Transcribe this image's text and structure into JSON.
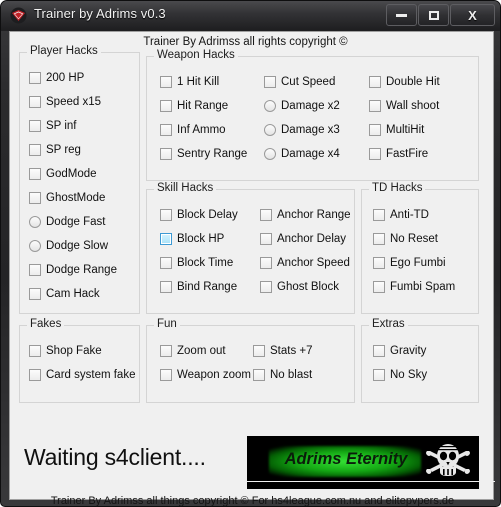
{
  "window": {
    "title": "Trainer by Adrims v0.3",
    "icon": "app-logo-icon",
    "buttons": {
      "minimize": "minimize-icon",
      "maximize": "maximize-icon",
      "close": "X"
    }
  },
  "header": {
    "copyright": "Trainer By Adrimss all rights copyright ©"
  },
  "groups": {
    "player_hacks": {
      "label": "Player Hacks",
      "items": [
        {
          "label": "200 HP",
          "type": "checkbox",
          "checked": false
        },
        {
          "label": "Speed x15",
          "type": "checkbox",
          "checked": false
        },
        {
          "label": "SP inf",
          "type": "checkbox",
          "checked": false
        },
        {
          "label": "SP reg",
          "type": "checkbox",
          "checked": false
        },
        {
          "label": "GodMode",
          "type": "checkbox",
          "checked": false
        },
        {
          "label": "GhostMode",
          "type": "checkbox",
          "checked": false
        },
        {
          "label": "Dodge Fast",
          "type": "radio",
          "checked": false
        },
        {
          "label": "Dodge Slow",
          "type": "radio",
          "checked": false
        },
        {
          "label": "Dodge Range",
          "type": "checkbox",
          "checked": false
        },
        {
          "label": "Cam Hack",
          "type": "checkbox",
          "checked": false
        }
      ]
    },
    "weapon_hacks": {
      "label": "Weapon Hacks",
      "columns": [
        [
          {
            "label": "1 Hit Kill",
            "type": "checkbox",
            "checked": false
          },
          {
            "label": "Hit Range",
            "type": "checkbox",
            "checked": false
          },
          {
            "label": "Inf Ammo",
            "type": "checkbox",
            "checked": false
          },
          {
            "label": "Sentry Range",
            "type": "checkbox",
            "checked": false
          }
        ],
        [
          {
            "label": "Cut Speed",
            "type": "checkbox",
            "checked": false
          },
          {
            "label": "Damage x2",
            "type": "radio",
            "checked": false
          },
          {
            "label": "Damage x3",
            "type": "radio",
            "checked": false
          },
          {
            "label": "Damage x4",
            "type": "radio",
            "checked": false
          }
        ],
        [
          {
            "label": "Double Hit",
            "type": "checkbox",
            "checked": false
          },
          {
            "label": "Wall shoot",
            "type": "checkbox",
            "checked": false
          },
          {
            "label": "MultiHit",
            "type": "checkbox",
            "checked": false
          },
          {
            "label": "FastFire",
            "type": "checkbox",
            "checked": false
          }
        ]
      ]
    },
    "skill_hacks": {
      "label": "Skill Hacks",
      "columns": [
        [
          {
            "label": "Block Delay",
            "type": "checkbox",
            "checked": false
          },
          {
            "label": "Block HP",
            "type": "checkbox",
            "checked": false,
            "hover": true
          },
          {
            "label": "Block Time",
            "type": "checkbox",
            "checked": false
          },
          {
            "label": "Bind Range",
            "type": "checkbox",
            "checked": false
          }
        ],
        [
          {
            "label": "Anchor Range",
            "type": "checkbox",
            "checked": false
          },
          {
            "label": "Anchor Delay",
            "type": "checkbox",
            "checked": false
          },
          {
            "label": "Anchor Speed",
            "type": "checkbox",
            "checked": false
          },
          {
            "label": "Ghost Block",
            "type": "checkbox",
            "checked": false
          }
        ]
      ]
    },
    "td_hacks": {
      "label": "TD Hacks",
      "items": [
        {
          "label": "Anti-TD",
          "type": "checkbox",
          "checked": false
        },
        {
          "label": "No Reset",
          "type": "checkbox",
          "checked": false
        },
        {
          "label": "Ego Fumbi",
          "type": "checkbox",
          "checked": false
        },
        {
          "label": "Fumbi Spam",
          "type": "checkbox",
          "checked": false
        }
      ]
    },
    "fakes": {
      "label": "Fakes",
      "items": [
        {
          "label": "Shop Fake",
          "type": "checkbox",
          "checked": false
        },
        {
          "label": "Card system fake",
          "type": "checkbox",
          "checked": false
        }
      ]
    },
    "fun": {
      "label": "Fun",
      "columns": [
        [
          {
            "label": "Zoom out",
            "type": "checkbox",
            "checked": false
          },
          {
            "label": "Weapon zoom",
            "type": "checkbox",
            "checked": false
          }
        ],
        [
          {
            "label": "Stats +7",
            "type": "checkbox",
            "checked": false
          },
          {
            "label": "No blast",
            "type": "checkbox",
            "checked": false
          }
        ]
      ]
    },
    "extras": {
      "label": "Extras",
      "items": [
        {
          "label": "Gravity",
          "type": "checkbox",
          "checked": false
        },
        {
          "label": "No Sky",
          "type": "checkbox",
          "checked": false
        }
      ]
    }
  },
  "status": {
    "text": "Waiting s4client...."
  },
  "banner": {
    "text": "Adrims Eternity",
    "glow_color": "#14a814",
    "background": "#000000",
    "skull": "pirate-skull-icon"
  },
  "footer": {
    "copyright": "Trainer By Adrimss all things copyright © For hs4league.com.nu and elitepvpers.de"
  }
}
